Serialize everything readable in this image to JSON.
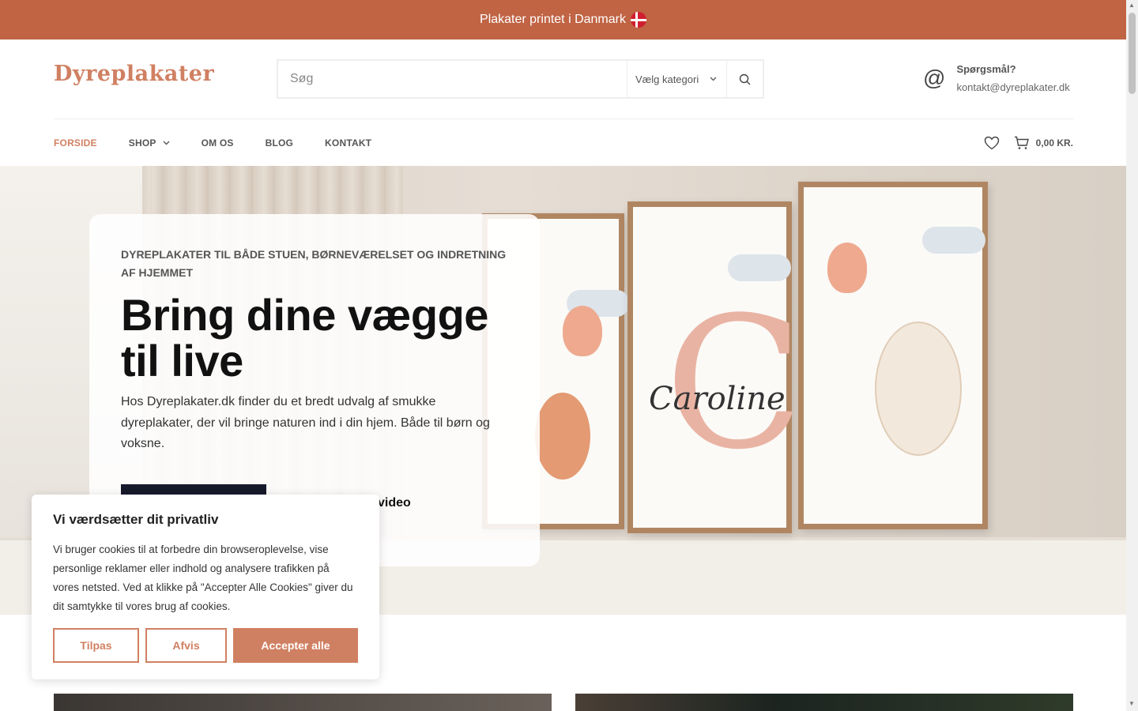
{
  "announcement": {
    "text": "Plakater printet i Danmark"
  },
  "header": {
    "logo": "Dyreplakater",
    "search_placeholder": "Søg",
    "category_label": "Vælg kategori",
    "contact_title": "Spørgsmål?",
    "contact_email": "kontakt@dyreplakater.dk"
  },
  "nav": {
    "items": [
      {
        "label": "FORSIDE",
        "active": true
      },
      {
        "label": "SHOP",
        "has_dropdown": true
      },
      {
        "label": "OM OS"
      },
      {
        "label": "BLOG"
      },
      {
        "label": "KONTAKT"
      }
    ],
    "cart_total": "0,00 KR."
  },
  "hero": {
    "eyebrow": "DYREPLAKATER TIL BÅDE STUEN, BØRNEVÆRELSET OG INDRETNING AF HJEMMET",
    "headline": "Bring dine vægge til live",
    "lead": "Hos Dyreplakater.dk finder du et bredt udvalg af smukke dyreplakater, der vil bringe naturen ind i din hjem. Både til børn og voksne.",
    "video_label": "video",
    "poster_name": "Caroline",
    "poster_letter": "C"
  },
  "cookie": {
    "title": "Vi værdsætter dit privatliv",
    "text": "Vi bruger cookies til at forbedre din browseroplevelse, vise personlige reklamer eller indhold og analysere trafikken på vores netsted. Ved at klikke på \"Accepter Alle Cookies\" giver du dit samtykke til vores brug af cookies.",
    "customize": "Tilpas",
    "reject": "Afvis",
    "accept": "Accepter alle"
  },
  "colors": {
    "brand": "#c06444",
    "accent": "#d08062",
    "dark_button": "#161a2b"
  }
}
